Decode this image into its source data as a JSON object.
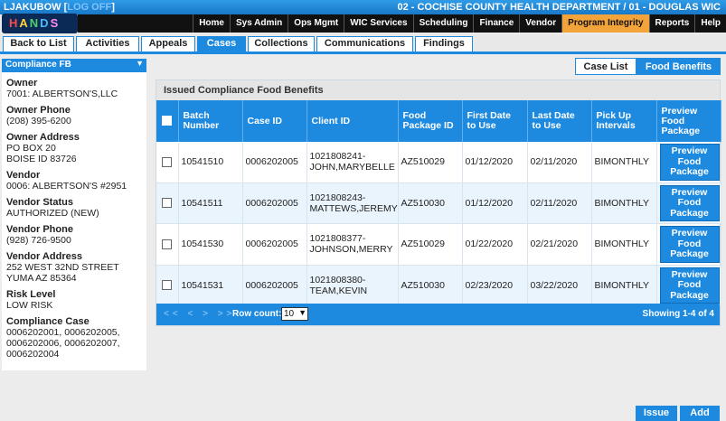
{
  "header": {
    "user": "LJAKUBOW",
    "logout_label": "LOG OFF",
    "org": "02 - COCHISE COUNTY HEALTH DEPARTMENT / 01 - DOUGLAS WIC",
    "logo_letters": [
      "H",
      "A",
      "N",
      "D",
      "S"
    ]
  },
  "nav": [
    {
      "label": "Home"
    },
    {
      "label": "Sys Admin"
    },
    {
      "label": "Ops Mgmt"
    },
    {
      "label": "WIC Services"
    },
    {
      "label": "Scheduling"
    },
    {
      "label": "Finance"
    },
    {
      "label": "Vendor"
    },
    {
      "label": "Program Integrity",
      "active": true
    },
    {
      "label": "Reports"
    },
    {
      "label": "Help"
    }
  ],
  "tabs": [
    {
      "label": "Back to List"
    },
    {
      "label": "Activities"
    },
    {
      "label": "Appeals"
    },
    {
      "label": "Cases",
      "active": true
    },
    {
      "label": "Collections"
    },
    {
      "label": "Communications"
    },
    {
      "label": "Findings"
    }
  ],
  "sidebar": {
    "select_value": "Compliance FB",
    "fields": [
      {
        "label": "Owner",
        "value": "7001: ALBERTSON'S,LLC"
      },
      {
        "label": "Owner Phone",
        "value": "(208) 395-6200"
      },
      {
        "label": "Owner Address",
        "value": "PO BOX 20\nBOISE ID 83726"
      },
      {
        "label": "Vendor",
        "value": "0006: ALBERTSON'S #2951"
      },
      {
        "label": "Vendor Status",
        "value": "AUTHORIZED (NEW)"
      },
      {
        "label": "Vendor Phone",
        "value": "(928) 726-9500"
      },
      {
        "label": "Vendor Address",
        "value": "252 WEST 32ND STREET\nYUMA AZ 85364"
      },
      {
        "label": "Risk Level",
        "value": "LOW RISK"
      },
      {
        "label": "Compliance Case",
        "value": "0006202001, 0006202005,\n0006202006, 0006202007,\n0006202004"
      }
    ]
  },
  "subtabs": [
    {
      "label": "Case List"
    },
    {
      "label": "Food Benefits",
      "active": true
    }
  ],
  "panel": {
    "title": "Issued Compliance Food Benefits",
    "columns": [
      "Batch Number",
      "Case ID",
      "Client ID",
      "Food Package ID",
      "First Date to Use",
      "Last Date to Use",
      "Pick Up Intervals",
      "Preview Food Package"
    ],
    "preview_label": "Preview Food Package",
    "rows": [
      {
        "batch": "10541510",
        "case_id": "0006202005",
        "client": "1021808241-JOHN,MARYBELLE",
        "package": "AZ510029",
        "first": "01/12/2020",
        "last": "02/11/2020",
        "interval": "BIMONTHLY"
      },
      {
        "batch": "10541511",
        "case_id": "0006202005",
        "client": "1021808243-MATTEWS,JEREMY",
        "package": "AZ510030",
        "first": "01/12/2020",
        "last": "02/11/2020",
        "interval": "BIMONTHLY"
      },
      {
        "batch": "10541530",
        "case_id": "0006202005",
        "client": "1021808377-JOHNSON,MERRY",
        "package": "AZ510029",
        "first": "01/22/2020",
        "last": "02/21/2020",
        "interval": "BIMONTHLY"
      },
      {
        "batch": "10541531",
        "case_id": "0006202005",
        "client": "1021808380-TEAM,KEVIN",
        "package": "AZ510030",
        "first": "02/23/2020",
        "last": "03/22/2020",
        "interval": "BIMONTHLY"
      }
    ],
    "pager": {
      "arrows": "<< < > >>",
      "row_count_label": "Row count:",
      "row_count_value": "10",
      "showing": "Showing 1-4 of 4"
    }
  },
  "footer": {
    "issue_label": "Issue",
    "add_label": "Add"
  }
}
